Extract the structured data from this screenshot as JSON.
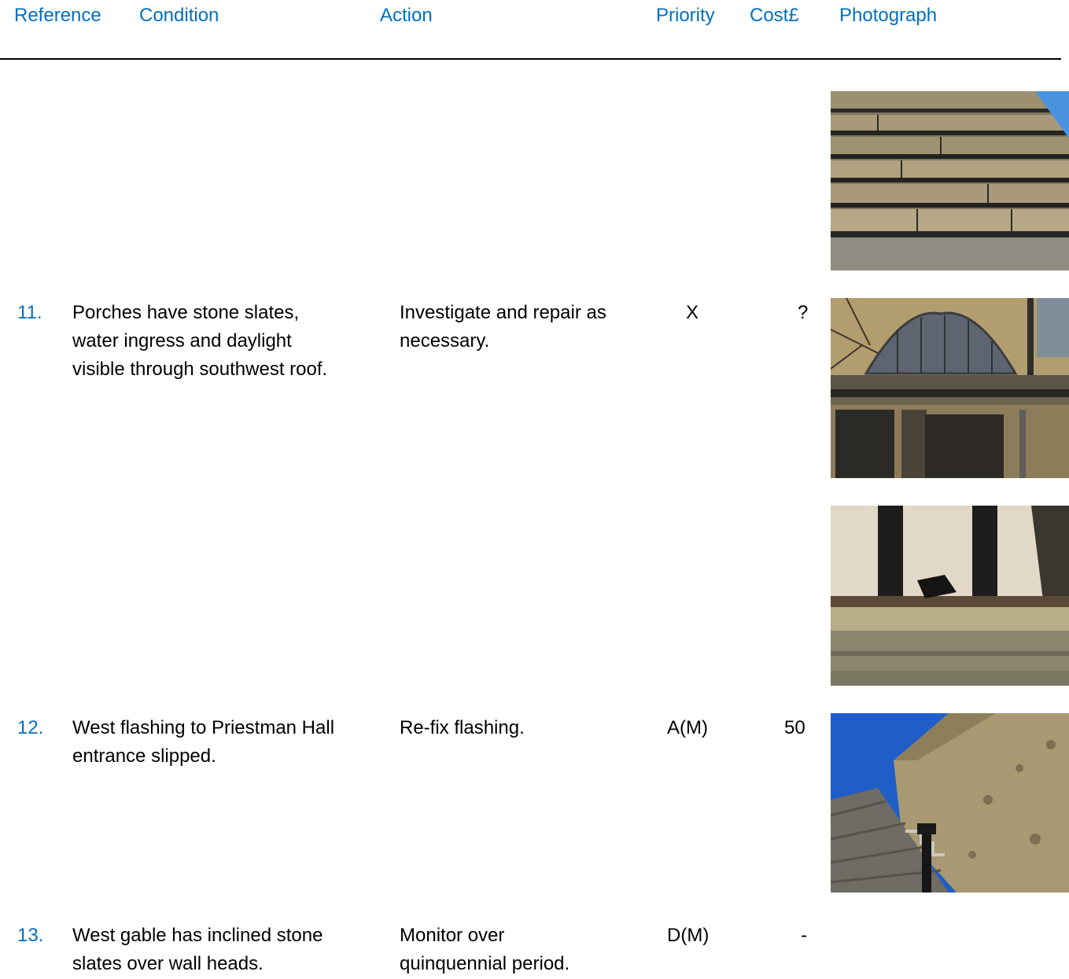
{
  "header": {
    "reference": "Reference",
    "condition": "Condition",
    "action": "Action",
    "priority": "Priority",
    "cost": "Cost£",
    "photograph": "Photograph"
  },
  "rows": [
    {
      "ref": "11.",
      "condition": [
        "Porches have stone slates,",
        "water ingress and daylight",
        "visible through southwest roof."
      ],
      "action": [
        "Investigate and repair as",
        "necessary."
      ],
      "priority": "X",
      "cost": "?"
    },
    {
      "ref": "12.",
      "condition": [
        "West flashing to Priestman Hall",
        "entrance slipped."
      ],
      "action": [
        "Re-fix flashing."
      ],
      "priority": "A(M)",
      "cost": "50"
    },
    {
      "ref": "13.",
      "condition": [
        "West gable has inclined stone",
        "slates over wall heads."
      ],
      "action": [
        "Monitor over",
        "quinquennial period."
      ],
      "priority": "D(M)",
      "cost": "-"
    }
  ],
  "photos": [
    {
      "subject": "stone-slate-roof"
    },
    {
      "subject": "porch-gable-window"
    },
    {
      "subject": "porch-roof-underside"
    },
    {
      "subject": "west-gable-wall"
    }
  ]
}
